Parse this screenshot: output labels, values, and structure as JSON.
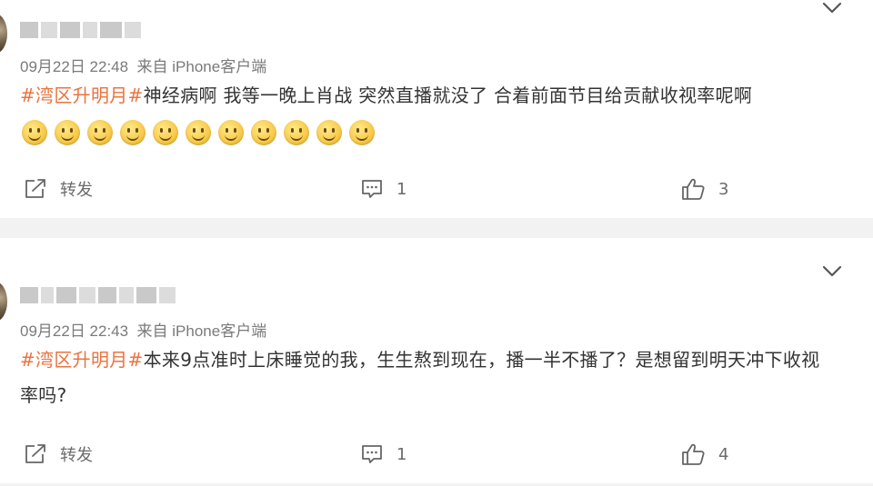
{
  "comments": [
    {
      "time": "09月22日 22:48",
      "source": "来自 iPhone客户端",
      "hashtag": "#湾区升明月#",
      "text": "神经病啊 我等一晚上肖战 突然直播就没了 合着前面节目给贡献收视率呢啊",
      "emoji_count": 11,
      "repost_label": "转发",
      "comment_count": "1",
      "like_count": "3"
    },
    {
      "time": "09月22日 22:43",
      "source": "来自 iPhone客户端",
      "hashtag": "#湾区升明月#",
      "text": "本来9点准时上床睡觉的我，生生熬到现在，播一半不播了？是想留到明天冲下收视率吗?",
      "emoji_count": 0,
      "repost_label": "转发",
      "comment_count": "1",
      "like_count": "4"
    }
  ],
  "icons": {
    "repost": "repost-icon",
    "comment": "comment-icon",
    "like": "like-icon",
    "more": "chevron-down-icon",
    "emoji": "smile-emoji-icon"
  },
  "colors": {
    "hashtag": "#eb7340",
    "meta": "#7a7a7a",
    "text": "#333333",
    "background": "#f2f2f2"
  }
}
